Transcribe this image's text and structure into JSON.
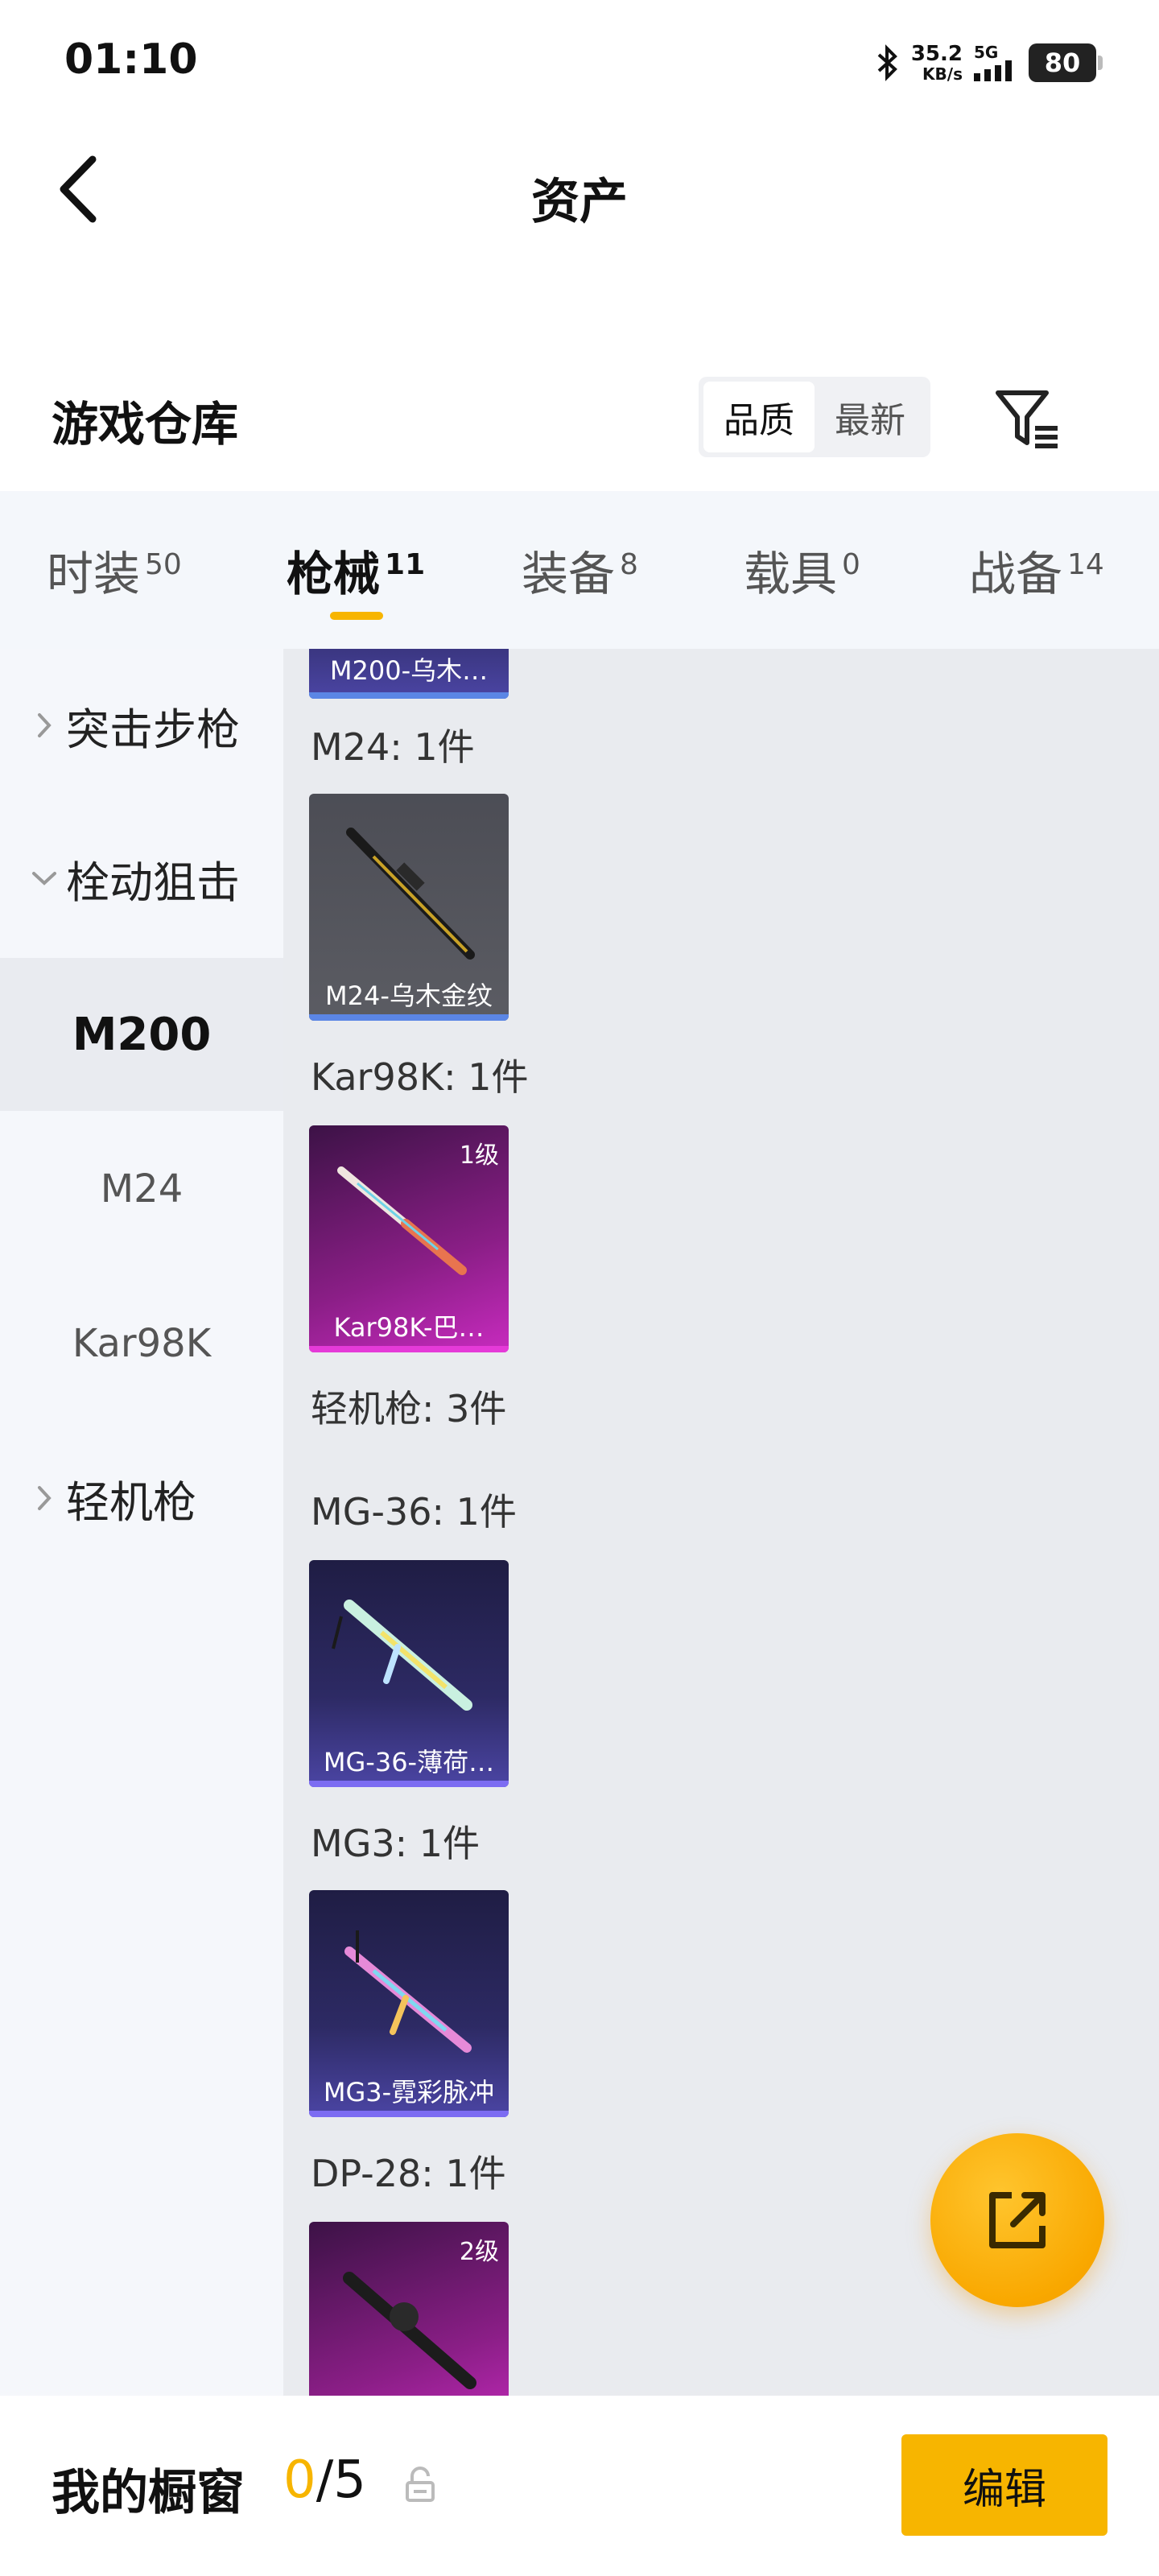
{
  "status_bar": {
    "time": "01:10",
    "net_speed": "35.2",
    "net_unit": "KB/s",
    "network": "5G",
    "battery": "80"
  },
  "header": {
    "title": "资产"
  },
  "section": {
    "title": "游戏仓库",
    "sort_options": [
      "品质",
      "最新"
    ],
    "sort_selected": "品质"
  },
  "tabs": [
    {
      "label": "时装",
      "count": "50"
    },
    {
      "label": "枪械",
      "count": "11"
    },
    {
      "label": "装备",
      "count": "8"
    },
    {
      "label": "载具",
      "count": "0"
    },
    {
      "label": "战备",
      "count": "14"
    }
  ],
  "active_tab": "枪械",
  "sidebar": {
    "groups": [
      {
        "label": "突击步枪",
        "expanded": false
      },
      {
        "label": "栓动狙击",
        "expanded": true
      },
      {
        "label": "轻机枪",
        "expanded": false
      }
    ],
    "sub_items": [
      "M200",
      "M24",
      "Kar98K"
    ],
    "selected_sub": "M200"
  },
  "content": {
    "partial_card": "M200-乌木…",
    "groups": [
      {
        "label": "M24: 1件",
        "item": {
          "name": "M24-乌木金纹",
          "level": "",
          "color": "gray"
        }
      },
      {
        "label": "Kar98K: 1件",
        "item": {
          "name": "Kar98K-巴…",
          "level": "1级",
          "color": "magenta"
        }
      },
      {
        "label": "轻机枪: 3件"
      },
      {
        "label": "MG-36: 1件",
        "item": {
          "name": "MG-36-薄荷…",
          "level": "",
          "color": "purple"
        }
      },
      {
        "label": "MG3: 1件",
        "item": {
          "name": "MG3-霓彩脉冲",
          "level": "",
          "color": "purple"
        }
      },
      {
        "label": "DP-28: 1件",
        "item": {
          "name": "",
          "level": "2级",
          "color": "magenta"
        }
      }
    ]
  },
  "bottom_bar": {
    "showcase_label": "我的橱窗",
    "showcase_current": "0",
    "showcase_total": "/5",
    "edit_label": "编辑"
  },
  "colors": {
    "accent": "#f7b500",
    "rarity_blue": "#5b86e5",
    "rarity_purple": "#7c6cf2",
    "rarity_magenta": "#e53ad8"
  }
}
